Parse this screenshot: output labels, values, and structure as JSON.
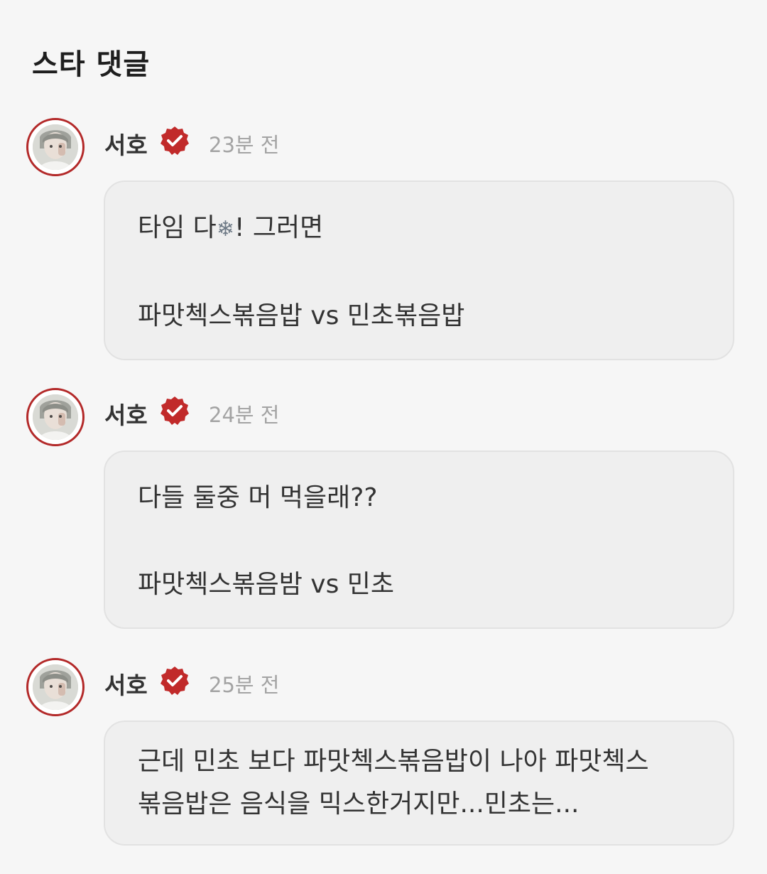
{
  "page": {
    "title": "스타 댓글"
  },
  "comments": [
    {
      "author": "서호",
      "time": "23분 전",
      "paragraph1": {
        "before_icon": "타임 다",
        "icon": "❄",
        "after_icon": "! 그러면"
      },
      "paragraph2": "파맛첵스볶음밥 vs 민초볶음밥"
    },
    {
      "author": "서호",
      "time": "24분 전",
      "paragraph1": "다들 둘중 머 먹을래??",
      "paragraph2": "파맛첵스볶음밤 vs 민초"
    },
    {
      "author": "서호",
      "time": "25분 전",
      "line1": "근데 민초 보다 파맛첵스볶음밥이 나아 파맛첵스",
      "line2": "볶음밥은 음식을 믹스한거지만...민초는..."
    }
  ],
  "colors": {
    "accent": "#b32929",
    "badge": "#c12a2a",
    "bubble": "#efefef",
    "background": "#f6f6f6",
    "timestamp": "#a3a3a3"
  },
  "icons": {
    "avatar": "user-avatar",
    "verified": "verified-badge-icon"
  }
}
